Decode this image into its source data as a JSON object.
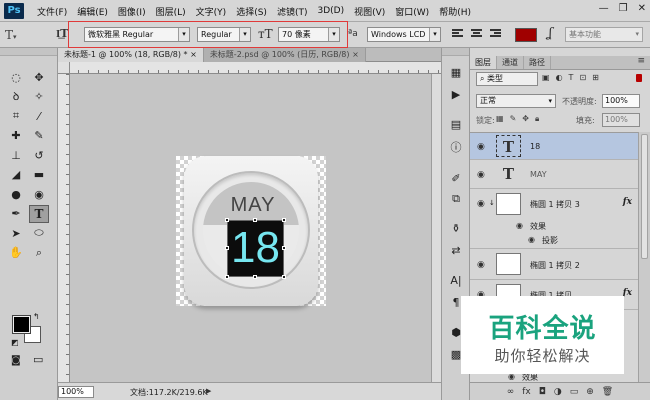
{
  "app": {
    "logo": "Ps"
  },
  "menu": [
    "文件(F)",
    "编辑(E)",
    "图像(I)",
    "图层(L)",
    "文字(Y)",
    "选择(S)",
    "滤镜(T)",
    "3D(D)",
    "视图(V)",
    "窗口(W)",
    "帮助(H)"
  ],
  "window_controls": {
    "minimize": "—",
    "restore": "❐",
    "close": "✕"
  },
  "options": {
    "tool_icon": "T",
    "font_family": "微软雅黑 Regular",
    "font_style": "Regular",
    "font_size": "70 像素",
    "antialias_label": "ªa",
    "antialias": "Windows LCD",
    "text_color": "#a00000",
    "workspace": "基本功能"
  },
  "tabs": [
    "未标题-1 @ 100% (18, RGB/8) *",
    "未标题-2.psd @ 100% (日历, RGB/8)"
  ],
  "status": {
    "zoom": "100%",
    "doc_info": "文档:117.2K/219.6K"
  },
  "canvas_text": {
    "month": "MAY",
    "day": "18"
  },
  "layers_panel": {
    "tabs": [
      "图层",
      "通道",
      "路径"
    ],
    "kind_filter": "类型",
    "blend_mode": "正常",
    "opacity_label": "不透明度:",
    "opacity": "100%",
    "lock_label": "锁定:",
    "fill_label": "填充:",
    "fill": "100%",
    "layers": [
      {
        "name": "18",
        "type": "text",
        "selected": true
      },
      {
        "name": "MAY",
        "type": "text"
      },
      {
        "name": "椭圆 1 拷贝 3",
        "type": "shape",
        "fx": "fx",
        "effects_label": "效果",
        "effects": [
          "投影"
        ]
      },
      {
        "name": "椭圆 1 拷贝 2",
        "type": "shape"
      },
      {
        "name": "椭圆 1 拷贝",
        "type": "shape",
        "fx": "fx"
      },
      {
        "name": "效果",
        "type": "effects"
      }
    ]
  },
  "watermark": {
    "title": "百科全说",
    "subtitle": "助你轻松解决"
  }
}
